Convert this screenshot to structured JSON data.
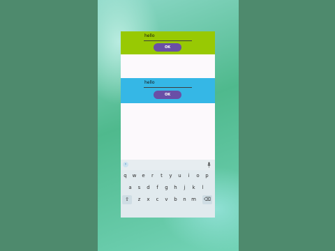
{
  "app": {
    "input_top_value": "hello",
    "input_mid_value": "hello",
    "button_top_label": "OK",
    "button_mid_label": "OK"
  },
  "keyboard": {
    "row1": [
      "q",
      "w",
      "e",
      "r",
      "t",
      "y",
      "u",
      "i",
      "o",
      "p"
    ],
    "row2": [
      "a",
      "s",
      "d",
      "f",
      "g",
      "h",
      "j",
      "k",
      "l"
    ],
    "row3": [
      "z",
      "x",
      "c",
      "v",
      "b",
      "n",
      "m"
    ]
  },
  "colors": {
    "top_panel": "#98c903",
    "mid_panel": "#35b7e6",
    "button": "#6a4fa6"
  },
  "icons": [
    "shift-icon",
    "backspace-icon",
    "mic-icon",
    "emoji-suggest-icon"
  ]
}
